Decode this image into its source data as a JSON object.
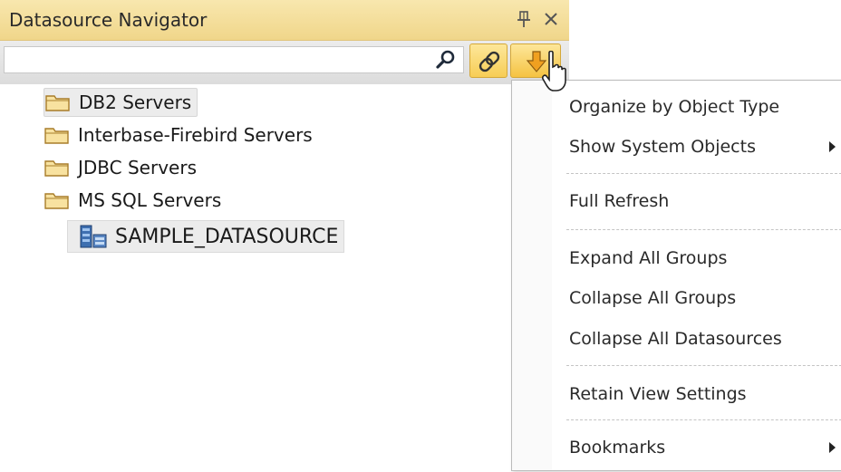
{
  "panel": {
    "title": "Datasource Navigator",
    "search_value": "",
    "accent": "#f0d68a"
  },
  "tree": {
    "items": [
      {
        "label": "DB2 Servers",
        "selected": true
      },
      {
        "label": "Interbase-Firebird Servers"
      },
      {
        "label": "JDBC Servers"
      },
      {
        "label": "MS SQL Servers"
      }
    ],
    "child": {
      "label": "SAMPLE_DATASOURCE"
    }
  },
  "menu": {
    "items": [
      {
        "label": "Organize by Object Type"
      },
      {
        "label": "Show System Objects",
        "submenu": true
      },
      {
        "label": "Full Refresh"
      },
      {
        "label": "Expand All Groups"
      },
      {
        "label": "Collapse All Groups"
      },
      {
        "label": "Collapse All Datasources"
      },
      {
        "label": "Retain View Settings"
      },
      {
        "label": "Bookmarks",
        "submenu": true
      }
    ]
  },
  "icons": {
    "pin": "pin-icon",
    "close": "close-icon",
    "search": "search-icon",
    "link": "link-icon",
    "dropdown": "dropdown-arrow-icon",
    "folder": "folder-icon",
    "datasource": "database-icon",
    "cursor": "mouse-cursor-icon"
  }
}
